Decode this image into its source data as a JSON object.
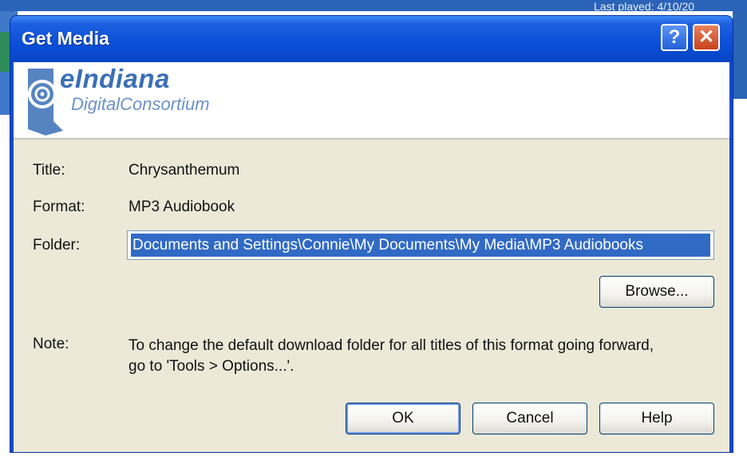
{
  "background": {
    "caption": "Last played: 4/10/20"
  },
  "window": {
    "title": "Get Media",
    "help_button": "?",
    "close_button": "✕"
  },
  "banner": {
    "brand_name": "eIndiana",
    "brand_subtitle": "DigitalConsortium"
  },
  "fields": {
    "title_label": "Title:",
    "title_value": "Chrysanthemum",
    "format_label": "Format:",
    "format_value": "MP3 Audiobook",
    "folder_label": "Folder:",
    "folder_value": "Documents and Settings\\Connie\\My Documents\\My Media\\MP3 Audiobooks"
  },
  "browse_button": "Browse...",
  "note": {
    "label": "Note:",
    "text_line1": "To change the default download folder for all titles of this format going forward,",
    "text_line2": "go to 'Tools > Options...'."
  },
  "actions": {
    "ok": "OK",
    "cancel": "Cancel",
    "help": "Help"
  },
  "colors": {
    "titlebar": "#0a4fd8",
    "dialog_face": "#ece9d8",
    "selection": "#316ac5",
    "brand_blue": "#3a6fb6"
  }
}
